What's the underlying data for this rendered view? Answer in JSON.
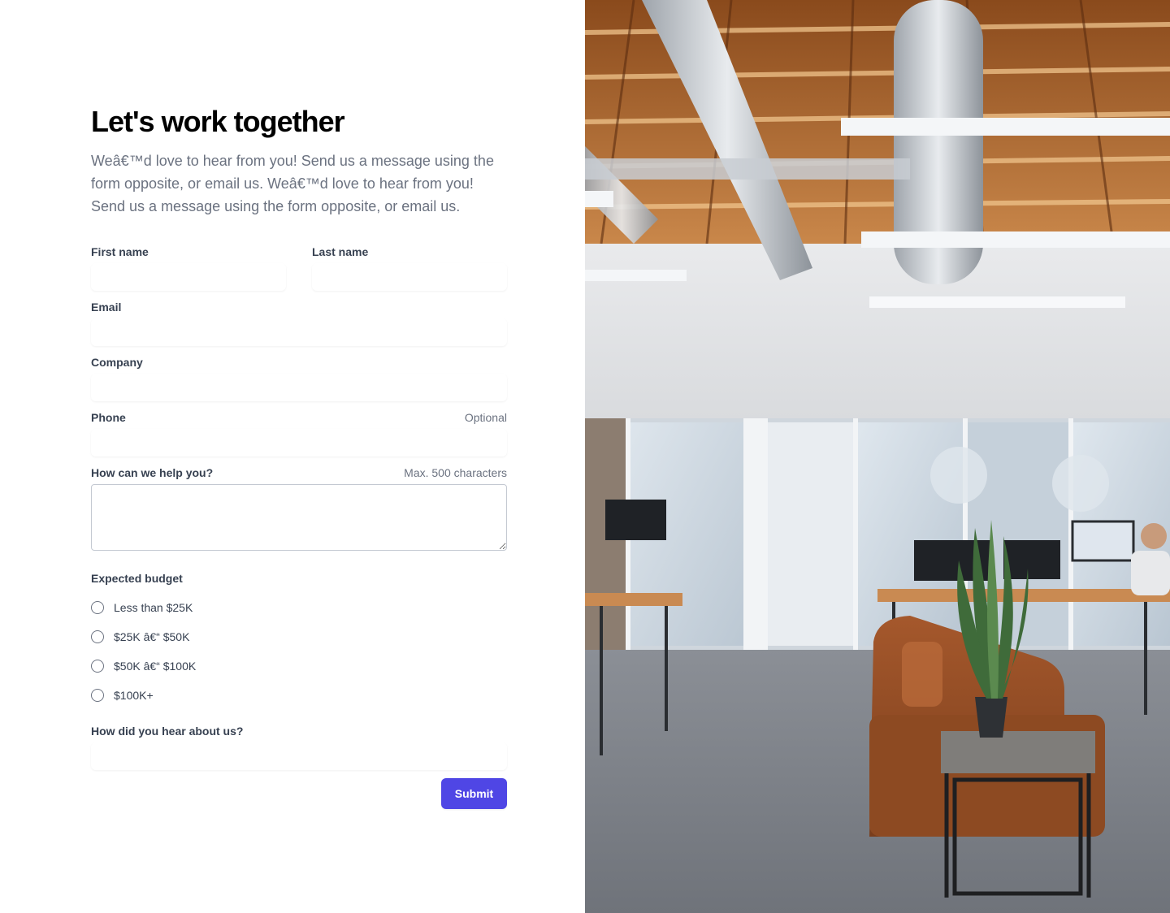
{
  "header": {
    "title": "Let's work together",
    "intro": "Weâ€™d love to hear from you! Send us a message using the form opposite, or email us. Weâ€™d love to hear from you! Send us a message using the form opposite, or email us."
  },
  "form": {
    "first_name": {
      "label": "First name",
      "value": "",
      "placeholder": ""
    },
    "last_name": {
      "label": "Last name",
      "value": "",
      "placeholder": ""
    },
    "email": {
      "label": "Email",
      "value": "",
      "placeholder": ""
    },
    "company": {
      "label": "Company",
      "value": "",
      "placeholder": ""
    },
    "phone": {
      "label": "Phone",
      "hint": "Optional",
      "value": "",
      "placeholder": ""
    },
    "message": {
      "label": "How can we help you?",
      "hint": "Max. 500 characters",
      "value": ""
    },
    "budget": {
      "label": "Expected budget",
      "options": [
        "Less than $25K",
        "$25K â€“ $50K",
        "$50K â€“ $100K",
        "$100K+"
      ],
      "selected": null
    },
    "referral": {
      "label": "How did you hear about us?",
      "value": "",
      "placeholder": ""
    },
    "submit_label": "Submit"
  },
  "colors": {
    "accent": "#4f46e5",
    "heading": "#000000",
    "body_text": "#6b7280",
    "label_text": "#374151"
  },
  "image": {
    "subject": "open-plan office with exposed wooden ceiling, ducts, glass-walled meeting rooms, desks and a leather sofa with a potted snake plant"
  }
}
